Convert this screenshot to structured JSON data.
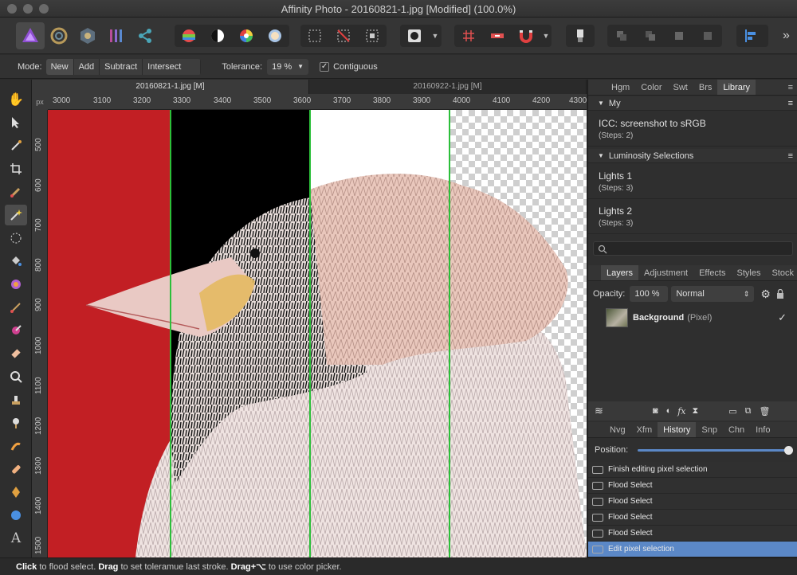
{
  "window": {
    "title": "Affinity Photo - 20160821-1.jpg [Modified] (100.0%)"
  },
  "toolbar": {
    "overflow_label": "»"
  },
  "context": {
    "mode_label": "Mode:",
    "mode_options": [
      "New",
      "Add",
      "Subtract",
      "Intersect"
    ],
    "tolerance_label": "Tolerance:",
    "tolerance_value": "19 %",
    "contiguous_label": "Contiguous",
    "contiguous_checked": true
  },
  "documents": {
    "tabs": [
      "20160821-1.jpg [M]",
      "20160922-1.jpg [M]"
    ]
  },
  "rulers": {
    "unit": "px",
    "horizontal": [
      "3000",
      "3100",
      "3200",
      "3300",
      "3400",
      "3500",
      "3600",
      "3700",
      "3800",
      "3900",
      "4000",
      "4100",
      "4200",
      "4300"
    ],
    "vertical": [
      "500",
      "600",
      "700",
      "800",
      "900",
      "1000",
      "1100",
      "1200",
      "1300",
      "1400",
      "1500"
    ]
  },
  "library_panel": {
    "tabs": [
      "Hgm",
      "Color",
      "Swt",
      "Brs",
      "Library"
    ],
    "active_tab": "Library",
    "groups": [
      {
        "name": "My",
        "items": [
          {
            "name": "ICC: screenshot to sRGB",
            "steps": "(Steps: 2)"
          }
        ]
      },
      {
        "name": "Luminosity Selections",
        "items": [
          {
            "name": "Lights 1",
            "steps": "(Steps: 3)"
          },
          {
            "name": "Lights 2",
            "steps": "(Steps: 3)"
          }
        ]
      }
    ]
  },
  "layers_panel": {
    "tabs": [
      "Layers",
      "Adjustment",
      "Effects",
      "Styles",
      "Stock"
    ],
    "active_tab": "Layers",
    "opacity_label": "Opacity:",
    "opacity_value": "100 %",
    "blend_mode": "Normal",
    "layer": {
      "name": "Background",
      "type": "(Pixel)"
    }
  },
  "history_panel": {
    "tabs": [
      "Nvg",
      "Xfm",
      "History",
      "Snp",
      "Chn",
      "Info"
    ],
    "active_tab": "History",
    "position_label": "Position:",
    "entries": [
      "Finish editing pixel selection",
      "Flood Select",
      "Flood Select",
      "Flood Select",
      "Flood Select",
      "Edit pixel selection"
    ],
    "selected_index": 5
  },
  "status": {
    "click": "Click",
    "click_text": " to flood select. ",
    "drag": "Drag",
    "drag_text": " to set toleramue last stroke. ",
    "drag2": "Drag+⌥",
    "drag2_text": " to use color picker."
  },
  "colors": {
    "selection_line": "#2cbf3a",
    "red_panel": "#c21f24",
    "history_selected": "#5b88c7"
  }
}
